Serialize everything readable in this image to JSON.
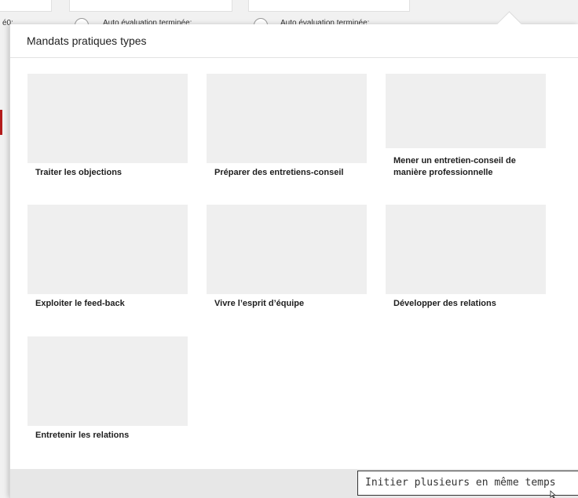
{
  "background": {
    "label_1": "é0:",
    "radio_label_1": "Auto évaluation terminée:",
    "radio_label_2": "Auto évaluation terminée:"
  },
  "modal": {
    "title": "Mandats pratiques types",
    "cards": [
      {
        "label": "Traiter les objections"
      },
      {
        "label": "Préparer des entretiens-conseil"
      },
      {
        "label": "Mener un entretien-conseil de manière professionnelle"
      },
      {
        "label": "Exploiter le feed-back"
      },
      {
        "label": "Vivre l’esprit d’équipe"
      },
      {
        "label": "Développer des relations"
      },
      {
        "label": "Entretenir les relations"
      }
    ]
  },
  "tooltip": {
    "text": "Initier plusieurs en même temps"
  },
  "icons": {
    "pointer": "mouse-pointer-icon"
  }
}
